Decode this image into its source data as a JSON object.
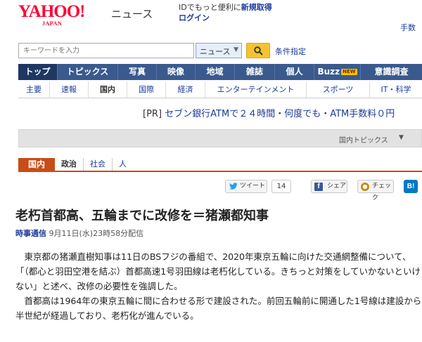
{
  "header": {
    "logo_text": "YAHOO!",
    "logo_sub": "JAPAN",
    "service_name": "ニュース",
    "id_promo": "IDでもっと便利に",
    "register_link": "新規取得",
    "login_link": "ログイン",
    "top_right_link": "手数"
  },
  "search": {
    "placeholder": "キーワードを入力",
    "scope": "ニュース",
    "advanced_link": "条件指定"
  },
  "global_nav": {
    "items": [
      {
        "label": "トップ"
      },
      {
        "label": "トピックス"
      },
      {
        "label": "写真"
      },
      {
        "label": "映像"
      },
      {
        "label": "地域"
      },
      {
        "label": "雑誌"
      },
      {
        "label": "個人"
      },
      {
        "label": "Buzz"
      },
      {
        "label": "意識調査"
      }
    ],
    "buzz_badge": "NEW"
  },
  "sub_nav": {
    "items": [
      {
        "label": "主要"
      },
      {
        "label": "速報"
      },
      {
        "label": "国内"
      },
      {
        "label": "国際"
      },
      {
        "label": "経済"
      },
      {
        "label": "エンターテインメント"
      },
      {
        "label": "スポーツ"
      },
      {
        "label": "IT・科学"
      }
    ]
  },
  "pr": {
    "tag": "[PR]",
    "text": "セブン銀行ATMで２４時間・何度でも・ATM手数料０円"
  },
  "topics_bar": {
    "label": "国内トピックス"
  },
  "category": {
    "main": "国内",
    "subs": [
      {
        "label": "政治"
      },
      {
        "label": "社会"
      },
      {
        "label": "人"
      }
    ]
  },
  "share": {
    "tweet_label": "ツイート",
    "tweet_count": "14",
    "fb_label": "シェア",
    "check_label": "チェック",
    "hatena_label": "B!"
  },
  "article": {
    "title": "老朽首都高、五輪までに改修を＝猪瀬都知事",
    "source": "時事通信",
    "date": "9月11日(水)23時58分配信",
    "paragraphs": [
      "東京都の猪瀬直樹知事は11日のBSフジの番組で、2020年東京五輪に向けた交通網整備について、「（都心と羽田空港を結ぶ）首都高速1号羽田線は老朽化している。きちっと対策をしていかないといけない」と述べ、改修の必要性を強調した。",
      "首都高は1964年の東京五輪に間に合わせる形で建設された。前回五輪前に開通した1号線は建設から半世紀が経過しており、老朽化が進んでいる。"
    ]
  },
  "colors": {
    "brand_red": "#ff0033",
    "nav_blue": "#3a5a8e",
    "category_orange": "#c74d16",
    "link_blue": "#1b3a9a"
  }
}
